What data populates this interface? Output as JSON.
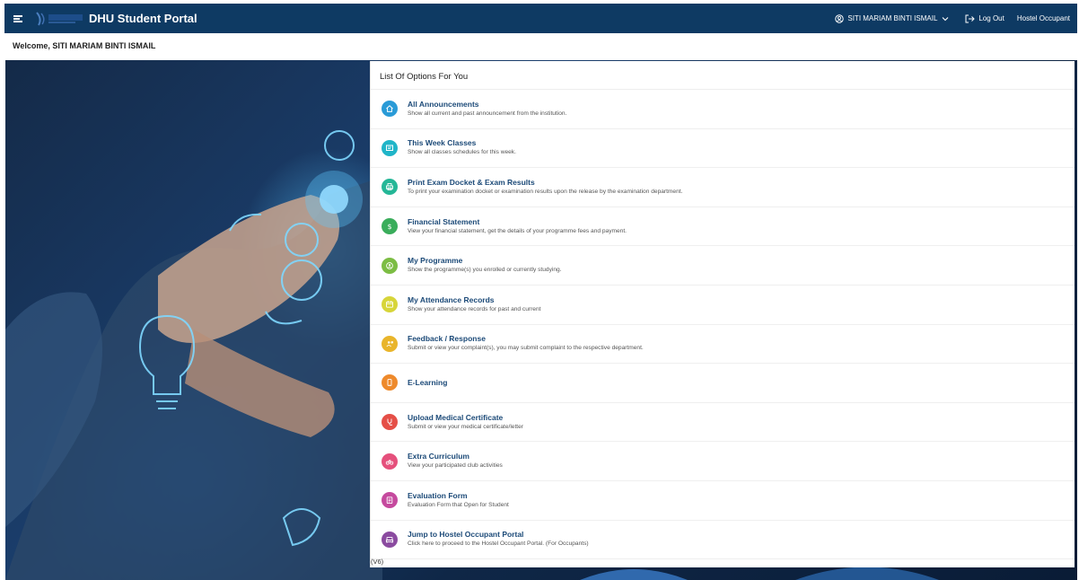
{
  "header": {
    "brand": "DHU Student Portal",
    "user_name": "SITI MARIAM BINTI ISMAIL",
    "logout_label": "Log Out",
    "hostel_label": "Hostel Occupant"
  },
  "welcome_text": "Welcome, SITI MARIAM BINTI ISMAIL",
  "panel": {
    "title": "List Of Options For You",
    "items": [
      {
        "title": "All Announcements",
        "desc": "Show all current and past announcement from the institution.",
        "color": "#2a9bd7",
        "icon": "home-icon"
      },
      {
        "title": "This Week Classes",
        "desc": "Show all classes schedules for this week.",
        "color": "#20b5c8",
        "icon": "board-icon"
      },
      {
        "title": "Print Exam Docket & Exam Results",
        "desc": "To print your examination docket or examination results upon the release by the examination department.",
        "color": "#25b797",
        "icon": "printer-icon"
      },
      {
        "title": "Financial Statement",
        "desc": "View your financial statement, get the details of your programme fees and payment.",
        "color": "#3aad5b",
        "icon": "dollar-icon"
      },
      {
        "title": "My Programme",
        "desc": "Show the programme(s) you enrolled or currently studying.",
        "color": "#7cbd44",
        "icon": "graduate-icon"
      },
      {
        "title": "My Attendance Records",
        "desc": "Show your attendance records for past and current",
        "color": "#d7d53a",
        "icon": "calendar-icon"
      },
      {
        "title": "Feedback / Response",
        "desc": "Submit or view your complaint(s), you may submit complaint to the respective department.",
        "color": "#e9b52b",
        "icon": "feedback-icon"
      },
      {
        "title": "E-Learning",
        "desc": "",
        "color": "#ee8a2c",
        "icon": "tablet-icon"
      },
      {
        "title": "Upload Medical Certificate",
        "desc": "Submit or view your medical certificate/letter",
        "color": "#e54f47",
        "icon": "medical-icon"
      },
      {
        "title": "Extra Curriculum",
        "desc": "View your participated club activities",
        "color": "#e5507c",
        "icon": "bicycle-icon"
      },
      {
        "title": "Evaluation Form",
        "desc": "Evaluation Form that Open for Student",
        "color": "#c54a9e",
        "icon": "clipboard-icon"
      },
      {
        "title": "Jump to Hostel Occupant Portal",
        "desc": "Click here to proceed to the Hostel Occupant Portal. (For Occupants)",
        "color": "#8b4ba0",
        "icon": "bed-icon"
      }
    ]
  },
  "version": "(V6)"
}
